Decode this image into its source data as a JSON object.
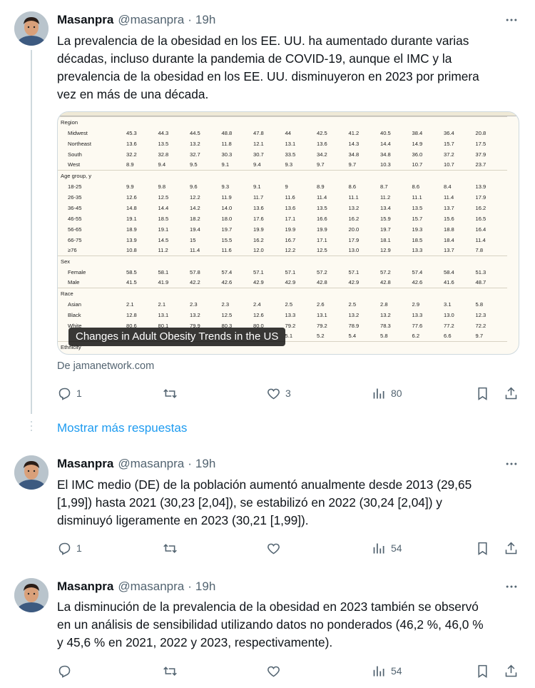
{
  "tweets": [
    {
      "name": "Masanpra",
      "handle": "@masanpra",
      "time": "19h",
      "lines": [
        "La prevalencia de la obesidad en los EE. UU. ha aumentado durante varias",
        "décadas, incluso durante la pandemia de COVID-19, aunque el IMC y la",
        "prevalencia de la obesidad en los EE. UU. disminuyeron en 2023 por primera",
        "vez en más de una década."
      ],
      "card": {
        "caption": "Changes in Adult Obesity Trends in the US",
        "source": "De jamanetwork.com",
        "table": [
          {
            "section": "Region",
            "rows": [
              {
                "label": "Midwest",
                "values": [
                  "45.3",
                  "44.3",
                  "44.5",
                  "48.8",
                  "47.8",
                  "44",
                  "42.5",
                  "41.2",
                  "40.5",
                  "38.4",
                  "36.4",
                  "20.8"
                ]
              },
              {
                "label": "Northeast",
                "values": [
                  "13.6",
                  "13.5",
                  "13.2",
                  "11.8",
                  "12.1",
                  "13.1",
                  "13.6",
                  "14.3",
                  "14.4",
                  "14.9",
                  "15.7",
                  "17.5"
                ]
              },
              {
                "label": "South",
                "values": [
                  "32.2",
                  "32.8",
                  "32.7",
                  "30.3",
                  "30.7",
                  "33.5",
                  "34.2",
                  "34.8",
                  "34.8",
                  "36.0",
                  "37.2",
                  "37.9"
                ]
              },
              {
                "label": "West",
                "values": [
                  "8.9",
                  "9.4",
                  "9.5",
                  "9.1",
                  "9.4",
                  "9.3",
                  "9.7",
                  "9.7",
                  "10.3",
                  "10.7",
                  "10.7",
                  "23.7"
                ]
              }
            ]
          },
          {
            "section": "Age group, y",
            "rows": [
              {
                "label": "18-25",
                "values": [
                  "9.9",
                  "9.8",
                  "9.6",
                  "9.3",
                  "9.1",
                  "9",
                  "8.9",
                  "8.6",
                  "8.7",
                  "8.6",
                  "8.4",
                  "13.9"
                ]
              },
              {
                "label": "26-35",
                "values": [
                  "12.6",
                  "12.5",
                  "12.2",
                  "11.9",
                  "11.7",
                  "11.6",
                  "11.4",
                  "11.1",
                  "11.2",
                  "11.1",
                  "11.4",
                  "17.9"
                ]
              },
              {
                "label": "36-45",
                "values": [
                  "14.8",
                  "14.4",
                  "14.2",
                  "14.0",
                  "13.6",
                  "13.6",
                  "13.5",
                  "13.2",
                  "13.4",
                  "13.5",
                  "13.7",
                  "16.2"
                ]
              },
              {
                "label": "46-55",
                "values": [
                  "19.1",
                  "18.5",
                  "18.2",
                  "18.0",
                  "17.6",
                  "17.1",
                  "16.6",
                  "16.2",
                  "15.9",
                  "15.7",
                  "15.6",
                  "16.5"
                ]
              },
              {
                "label": "56-65",
                "values": [
                  "18.9",
                  "19.1",
                  "19.4",
                  "19.7",
                  "19.9",
                  "19.9",
                  "19.9",
                  "20.0",
                  "19.7",
                  "19.3",
                  "18.8",
                  "16.4"
                ]
              },
              {
                "label": "66-75",
                "values": [
                  "13.9",
                  "14.5",
                  "15",
                  "15.5",
                  "16.2",
                  "16.7",
                  "17.1",
                  "17.9",
                  "18.1",
                  "18.5",
                  "18.4",
                  "11.4"
                ]
              },
              {
                "label": "≥76",
                "values": [
                  "10.8",
                  "11.2",
                  "11.4",
                  "11.6",
                  "12.0",
                  "12.2",
                  "12.5",
                  "13.0",
                  "12.9",
                  "13.3",
                  "13.7",
                  "7.8"
                ]
              }
            ]
          },
          {
            "section": "Sex",
            "rows": [
              {
                "label": "Female",
                "values": [
                  "58.5",
                  "58.1",
                  "57.8",
                  "57.4",
                  "57.1",
                  "57.1",
                  "57.2",
                  "57.1",
                  "57.2",
                  "57.4",
                  "58.4",
                  "51.3"
                ]
              },
              {
                "label": "Male",
                "values": [
                  "41.5",
                  "41.9",
                  "42.2",
                  "42.6",
                  "42.9",
                  "42.9",
                  "42.8",
                  "42.9",
                  "42.8",
                  "42.6",
                  "41.6",
                  "48.7"
                ]
              }
            ]
          },
          {
            "section": "Race",
            "rows": [
              {
                "label": "Asian",
                "values": [
                  "2.1",
                  "2.1",
                  "2.3",
                  "2.3",
                  "2.4",
                  "2.5",
                  "2.6",
                  "2.5",
                  "2.8",
                  "2.9",
                  "3.1",
                  "5.8"
                ]
              },
              {
                "label": "Black",
                "values": [
                  "12.8",
                  "13.1",
                  "13.2",
                  "12.5",
                  "12.6",
                  "13.3",
                  "13.1",
                  "13.2",
                  "13.2",
                  "13.3",
                  "13.0",
                  "12.3"
                ]
              },
              {
                "label": "White",
                "values": [
                  "80.6",
                  "80.1",
                  "79.9",
                  "80.3",
                  "80.0",
                  "79.2",
                  "79.2",
                  "78.9",
                  "78.3",
                  "77.6",
                  "77.2",
                  "72.2"
                ]
              },
              {
                "label": "",
                "values": [
                  "",
                  "",
                  "",
                  "",
                  "",
                  "5.1",
                  "5.2",
                  "5.4",
                  "5.8",
                  "6.2",
                  "6.6",
                  "9.7"
                ]
              }
            ]
          },
          {
            "section": "Ethnicity",
            "rows": []
          }
        ]
      },
      "actions": {
        "replies": "1",
        "reposts": "",
        "likes": "3",
        "views": "80"
      }
    },
    {
      "name": "Masanpra",
      "handle": "@masanpra",
      "time": "19h",
      "lines": [
        "El IMC medio (DE) de la población aumentó anualmente desde 2013 (29,65",
        "[1,99]) hasta 2021 (30,23 [2,04]), se estabilizó en 2022 (30,24 [2,04]) y",
        "disminuyó ligeramente en 2023 (30,21 [1,99])."
      ],
      "actions": {
        "replies": "1",
        "reposts": "",
        "likes": "",
        "views": "54"
      }
    },
    {
      "name": "Masanpra",
      "handle": "@masanpra",
      "time": "19h",
      "lines": [
        "La disminución de la prevalencia de la obesidad en 2023 también se observó",
        "en un análisis de sensibilidad utilizando datos no ponderados (46,2 %, 46,0 %",
        "y 45,6 % en 2021, 2022 y 2023, respectivamente)."
      ],
      "actions": {
        "replies": "",
        "reposts": "",
        "likes": "",
        "views": "54"
      }
    }
  ],
  "show_more": "Mostrar más respuestas",
  "icons": {
    "reply": "reply-icon",
    "repost": "repost-icon",
    "like": "heart-icon",
    "views": "views-icon",
    "bookmark": "bookmark-icon",
    "share": "share-icon",
    "more": "more-icon"
  },
  "colors": {
    "link": "#1d9bf0",
    "muted": "#536471",
    "text": "#0f1419"
  }
}
